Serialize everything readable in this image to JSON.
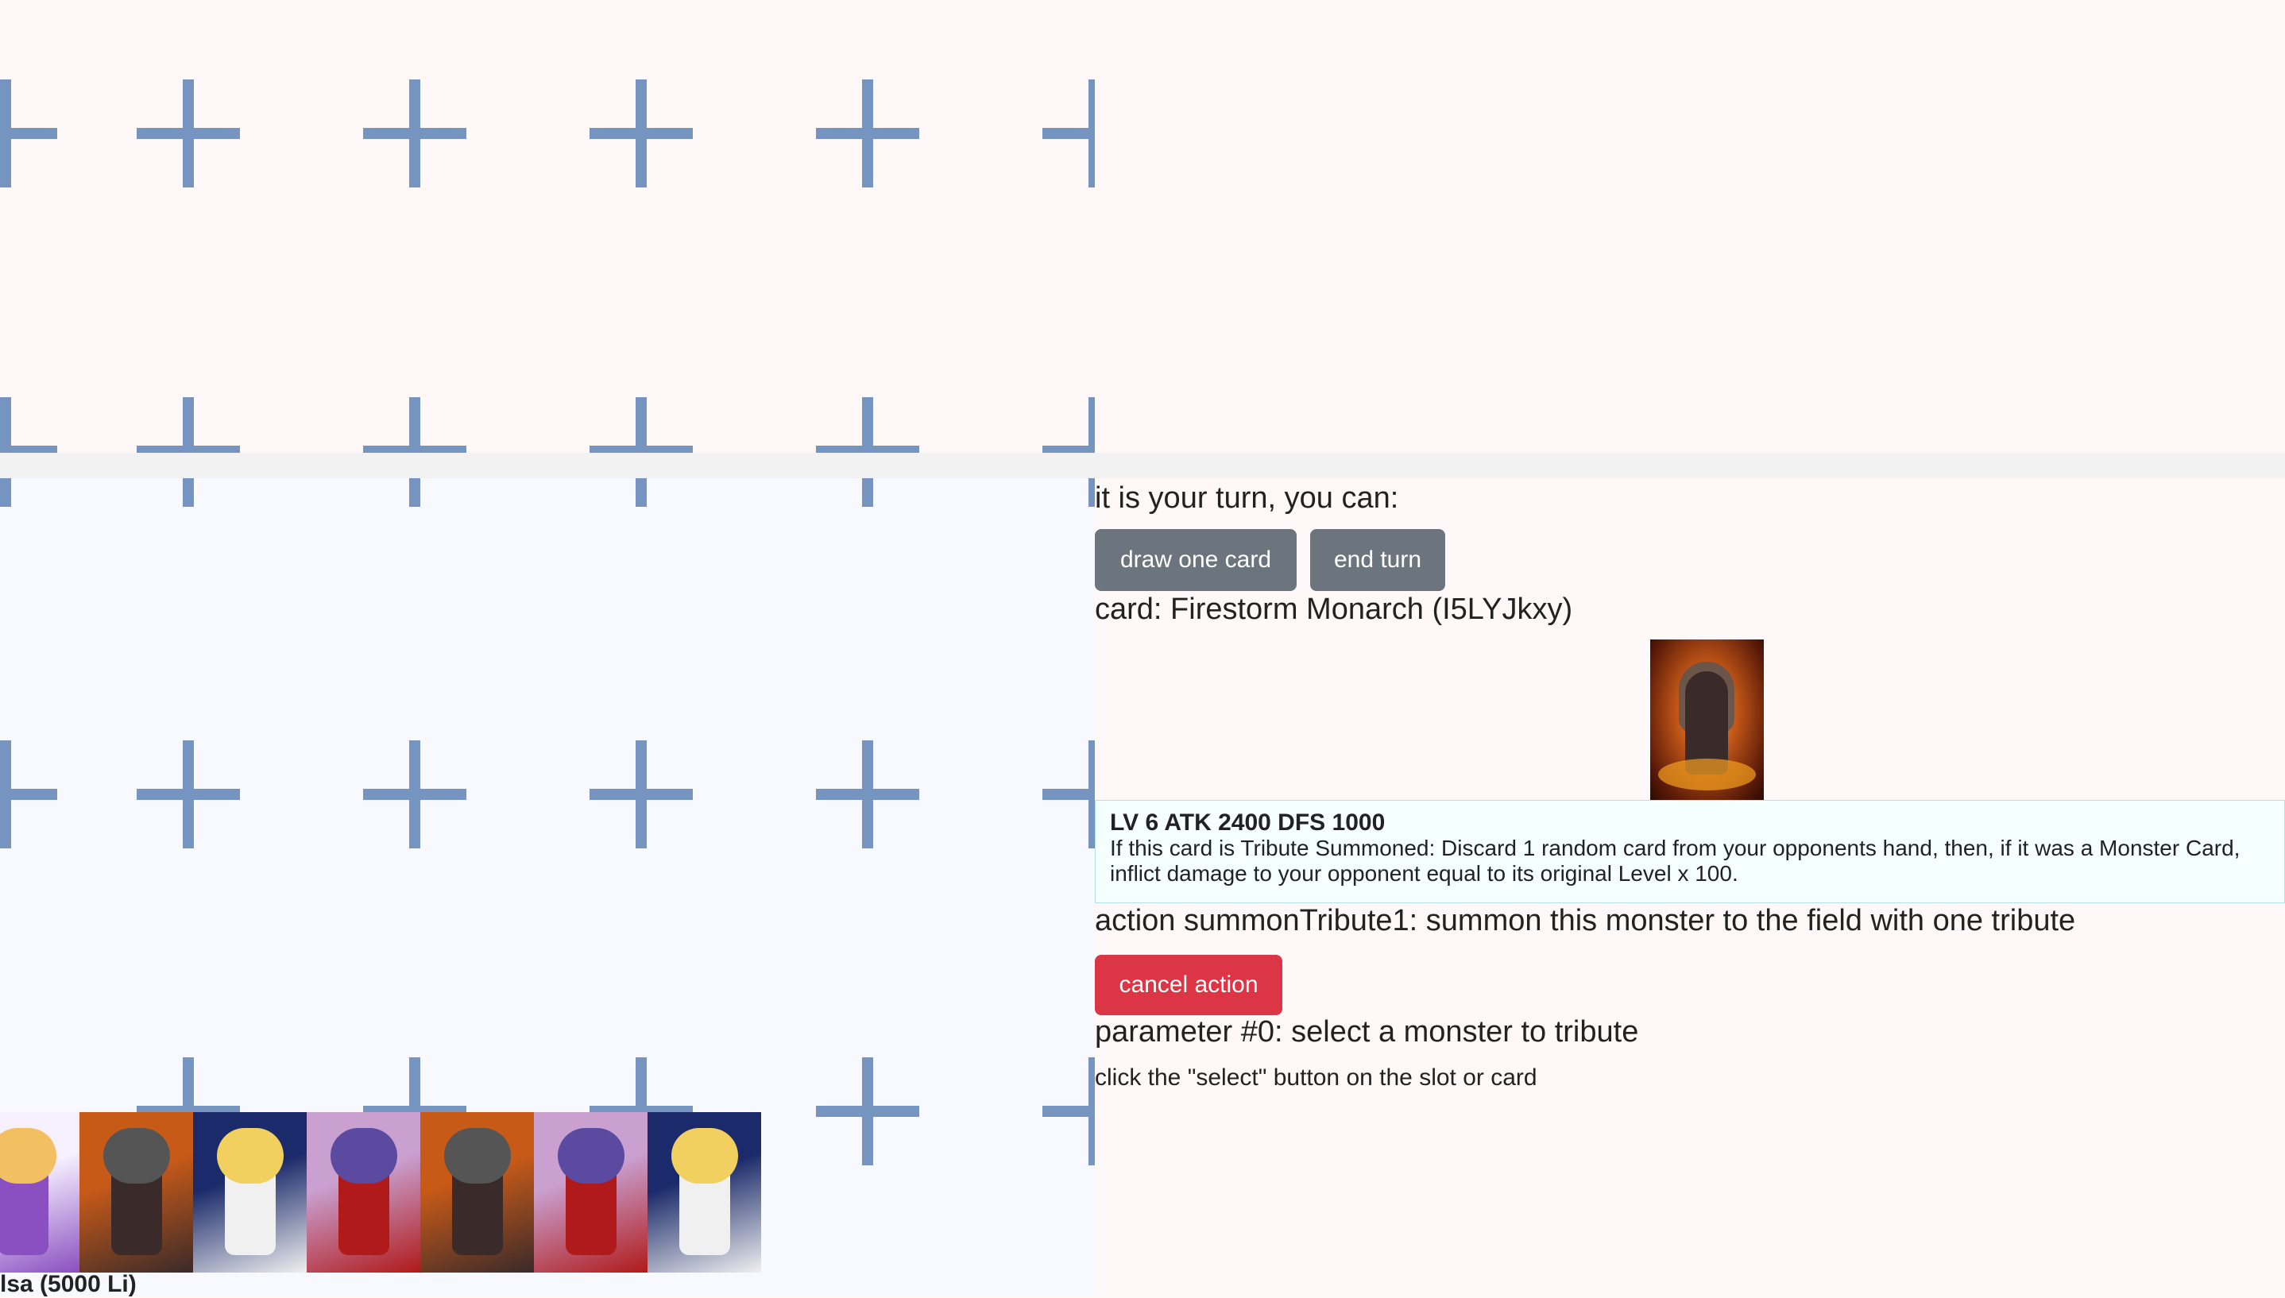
{
  "player": {
    "name": "lsa (5000 Li)"
  },
  "hand": [
    {
      "name": "hand-card-purple-witch",
      "colors": [
        "#f6f0ff",
        "#8a4fc0",
        "#f2c060"
      ]
    },
    {
      "name": "hand-card-firestorm",
      "colors": [
        "#c85a18",
        "#3a2a2a",
        "#555555"
      ]
    },
    {
      "name": "hand-card-blonde-witch",
      "colors": [
        "#1a2a6a",
        "#f0f0f0",
        "#f2d060"
      ]
    },
    {
      "name": "hand-card-red-dress",
      "colors": [
        "#c9a0d0",
        "#b01a1a",
        "#5a4aa0"
      ]
    },
    {
      "name": "hand-card-firestorm",
      "colors": [
        "#c85a18",
        "#3a2a2a",
        "#555555"
      ]
    },
    {
      "name": "hand-card-red-dress",
      "colors": [
        "#c9a0d0",
        "#b01a1a",
        "#5a4aa0"
      ]
    },
    {
      "name": "hand-card-blonde-witch",
      "colors": [
        "#1a2a6a",
        "#f0f0f0",
        "#f2d060"
      ]
    }
  ],
  "turn": {
    "heading": "it is your turn, you can:",
    "draw_label": "draw one card",
    "end_label": "end turn"
  },
  "card": {
    "title": "card: Firestorm Monarch (I5LYJkxy)",
    "stats": "LV 6 ATK 2400 DFS 1000",
    "description": "If this card is Tribute Summoned: Discard 1 random card from your opponents hand, then, if it was a Monster Card, inflict damage to your opponent equal to its original Level x 100."
  },
  "action": {
    "heading": "action summonTribute1: summon this monster to the field with one tribute",
    "cancel_label": "cancel action",
    "param_heading": "parameter #0: select a monster to tribute",
    "hint": "click the \"select\" button on the slot or card"
  },
  "colors": {
    "slot": "#7594bf",
    "button_gray": "#6c757d",
    "button_red": "#dc3545",
    "my_field_bg": "#f8f9ff",
    "page_bg": "#fff8f8"
  }
}
